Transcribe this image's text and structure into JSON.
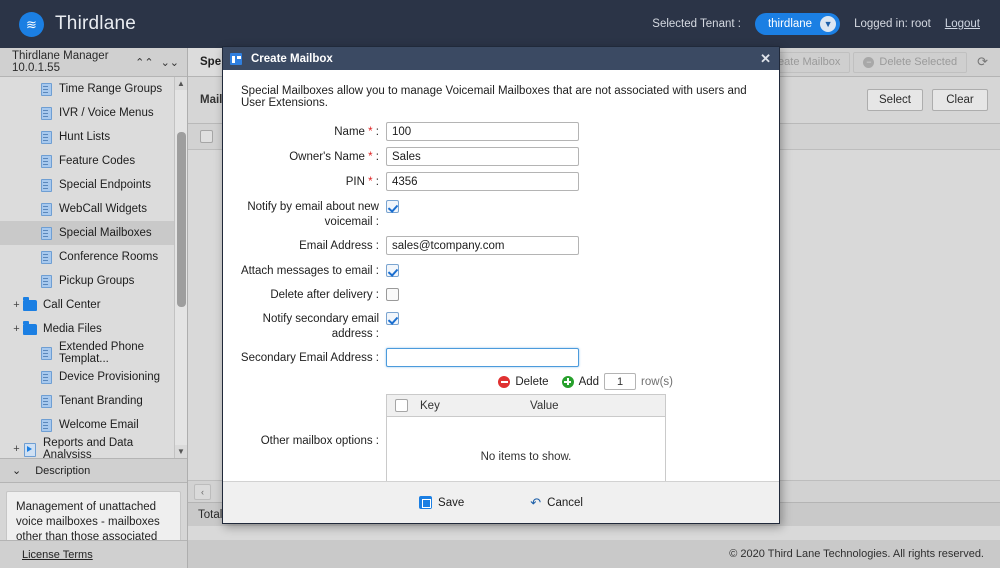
{
  "topbar": {
    "brand": "Thirdlane",
    "logo_icon": "thirdlane-logo-icon",
    "tenant_label": "Selected Tenant :",
    "tenant_value": "thirdlane",
    "tenant_caret_icon": "chevron-down-icon",
    "logged_in": "Logged in: root",
    "logout": "Logout",
    "bg": "#2b3447",
    "accent": "#1b7fe3"
  },
  "sidebar": {
    "header_title": "Thirdlane Manager 10.0.1.55",
    "collapse_icon": "chevrons-up-icon",
    "expand_icon": "chevrons-down-icon",
    "scroll_up_icon": "caret-up-icon",
    "scroll_down_icon": "caret-down-icon",
    "items": [
      {
        "label": "Time Range Groups",
        "icon": "page-icon",
        "twisty": "",
        "indent": 1,
        "selected": false
      },
      {
        "label": "IVR / Voice Menus",
        "icon": "page-icon",
        "twisty": "",
        "indent": 1,
        "selected": false
      },
      {
        "label": "Hunt Lists",
        "icon": "page-icon",
        "twisty": "",
        "indent": 1,
        "selected": false
      },
      {
        "label": "Feature Codes",
        "icon": "page-icon",
        "twisty": "",
        "indent": 1,
        "selected": false
      },
      {
        "label": "Special Endpoints",
        "icon": "page-icon",
        "twisty": "",
        "indent": 1,
        "selected": false
      },
      {
        "label": "WebCall Widgets",
        "icon": "page-icon",
        "twisty": "",
        "indent": 1,
        "selected": false
      },
      {
        "label": "Special Mailboxes",
        "icon": "page-icon",
        "twisty": "",
        "indent": 1,
        "selected": true
      },
      {
        "label": "Conference Rooms",
        "icon": "page-icon",
        "twisty": "",
        "indent": 1,
        "selected": false
      },
      {
        "label": "Pickup Groups",
        "icon": "page-icon",
        "twisty": "",
        "indent": 1,
        "selected": false
      },
      {
        "label": "Call Center",
        "icon": "folder-icon",
        "twisty": "+",
        "indent": 0,
        "selected": false
      },
      {
        "label": "Media Files",
        "icon": "folder-icon",
        "twisty": "+",
        "indent": 0,
        "selected": false
      },
      {
        "label": "Extended Phone Templat...",
        "icon": "page-icon",
        "twisty": "",
        "indent": 1,
        "selected": false
      },
      {
        "label": "Device Provisioning",
        "icon": "page-icon",
        "twisty": "",
        "indent": 1,
        "selected": false
      },
      {
        "label": "Tenant Branding",
        "icon": "page-icon",
        "twisty": "",
        "indent": 1,
        "selected": false
      },
      {
        "label": "Welcome Email",
        "icon": "page-icon",
        "twisty": "",
        "indent": 1,
        "selected": false
      },
      {
        "label": "Reports and Data Analysiss",
        "icon": "report-icon",
        "twisty": "+",
        "indent": 0,
        "selected": false
      }
    ],
    "description_header": "Description",
    "description_caret_icon": "chevron-down-icon",
    "description_text": "Management of unattached voice mailboxes - mailboxes other than those associated with User Extensions.",
    "license_terms": "License Terms"
  },
  "main": {
    "tab_label": "Spe",
    "create_button": "Create Mailbox",
    "create_icon": "plus-circle-icon",
    "delete_button": "Delete Selected",
    "delete_icon": "minus-circle-icon",
    "refresh_icon": "refresh-icon",
    "filter_label": "Mailbo",
    "select_button": "Select",
    "clear_button": "Clear",
    "pager_prev_icon": "chevron-left-icon",
    "total_text": "Total: 0",
    "copyright": "© 2020 Third Lane Technologies. All rights reserved."
  },
  "dialog": {
    "title": "Create Mailbox",
    "title_icon": "window-icon",
    "close_icon": "close-icon",
    "intro": "Special Mailboxes allow you to manage Voicemail Mailboxes that are not associated with users and User Extensions.",
    "fields": [
      {
        "label": "Name",
        "required": true,
        "type": "text",
        "value": "100"
      },
      {
        "label": "Owner's Name",
        "required": true,
        "type": "text",
        "value": "Sales"
      },
      {
        "label": "PIN",
        "required": true,
        "type": "text",
        "value": "4356"
      },
      {
        "label": "Notify by email about new voicemail",
        "required": false,
        "type": "checkbox",
        "checked": true
      },
      {
        "label": "Email Address",
        "required": false,
        "type": "text",
        "value": "sales@tcompany.com"
      },
      {
        "label": "Attach messages to email",
        "required": false,
        "type": "checkbox",
        "checked": true
      },
      {
        "label": "Delete after delivery",
        "required": false,
        "type": "checkbox",
        "checked": false
      },
      {
        "label": "Notify secondary email address",
        "required": false,
        "type": "checkbox",
        "checked": true
      },
      {
        "label": "Secondary Email Address",
        "required": false,
        "type": "text",
        "value": "",
        "focused": true
      }
    ],
    "kv": {
      "delete_label": "Delete",
      "delete_icon": "minus-circle-icon",
      "add_label": "Add",
      "add_icon": "plus-circle-icon",
      "rows_value": "1",
      "rows_suffix": "row(s)",
      "options_label": "Other mailbox options :",
      "columns": [
        "Key",
        "Value"
      ],
      "empty_text": "No items to show.",
      "rows": []
    },
    "save_label": "Save",
    "save_icon": "save-icon",
    "cancel_label": "Cancel",
    "cancel_icon": "undo-arrow-icon"
  }
}
